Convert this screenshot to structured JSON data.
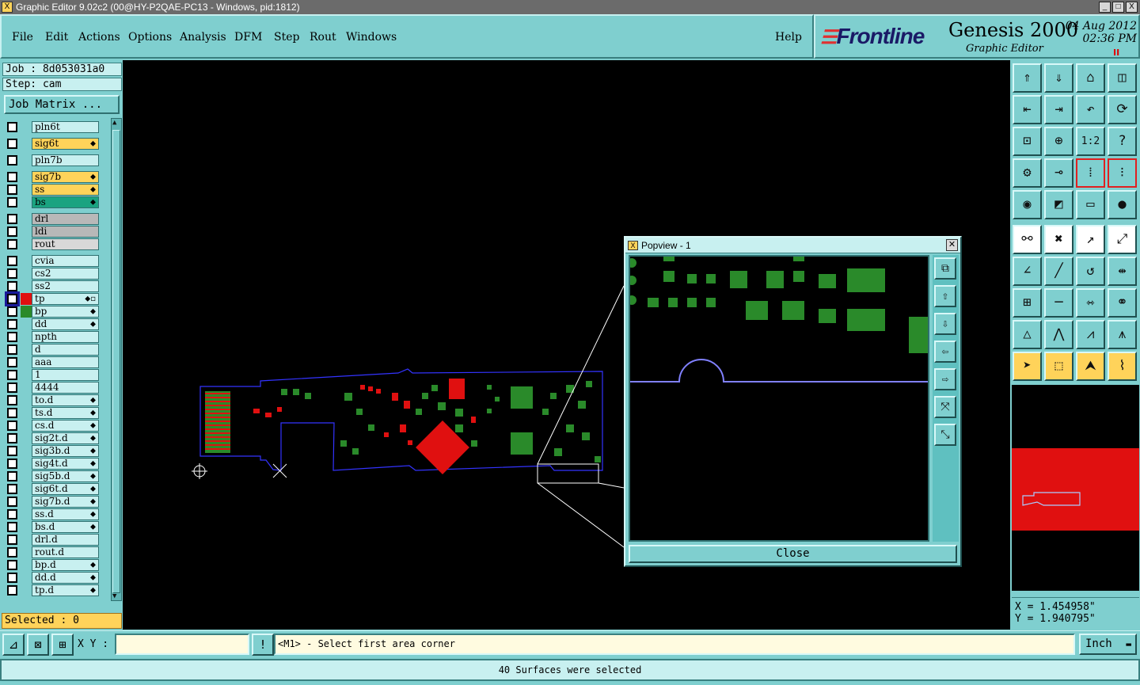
{
  "window": {
    "title": "Graphic Editor 9.02c2 (00@HY-P2QAE-PC13 - Windows, pid:1812)",
    "app_icon": "X",
    "minimize": "_",
    "maximize": "□",
    "close": "X"
  },
  "menu": [
    "File",
    "Edit",
    "Actions",
    "Options",
    "Analysis",
    "DFM",
    "Step",
    "Rout",
    "Windows",
    "Help"
  ],
  "brand": {
    "logo": "Frontline",
    "product": "Genesis 2000",
    "subtitle": "Graphic Editor",
    "date": "04 Aug 2012",
    "time": "02:36 PM",
    "pause": "II"
  },
  "job": {
    "label": "Job : 8d053031a0",
    "step": "Step: cam",
    "matrix_button": "Job Matrix ..."
  },
  "layers": [
    {
      "name": "pln6t",
      "color": "#c8f0f0",
      "swatch": "",
      "flag": ""
    },
    {
      "name": "sig6t",
      "color": "#ffd35a",
      "swatch": "",
      "flag": "⬥"
    },
    {
      "name": "pln7b",
      "color": "#c8f0f0",
      "swatch": "",
      "flag": ""
    },
    {
      "name": "sig7b",
      "color": "#ffd35a",
      "swatch": "",
      "flag": "⬥"
    },
    {
      "name": "ss",
      "color": "#ffd35a",
      "swatch": "",
      "flag": "⬥"
    },
    {
      "name": "bs",
      "color": "#1aa380",
      "swatch": "",
      "flag": "⬥"
    },
    {
      "name": "drl",
      "color": "#b8b8b8",
      "swatch": "",
      "flag": ""
    },
    {
      "name": "ldi",
      "color": "#b8b8b8",
      "swatch": "",
      "flag": ""
    },
    {
      "name": "rout",
      "color": "#d8d8d8",
      "swatch": "",
      "flag": ""
    },
    {
      "name": "cvia",
      "color": "#c8f0f0",
      "swatch": "",
      "flag": ""
    },
    {
      "name": "cs2",
      "color": "#c8f0f0",
      "swatch": "",
      "flag": ""
    },
    {
      "name": "ss2",
      "color": "#c8f0f0",
      "swatch": "",
      "flag": ""
    },
    {
      "name": "tp",
      "color": "#c8f0f0",
      "swatch": "#e01010",
      "flag": "⬥▫"
    },
    {
      "name": "bp",
      "color": "#c8f0f0",
      "swatch": "#2a8a2a",
      "flag": "⬥"
    },
    {
      "name": "dd",
      "color": "#c8f0f0",
      "swatch": "",
      "flag": "⬥"
    },
    {
      "name": "npth",
      "color": "#c8f0f0",
      "swatch": "",
      "flag": ""
    },
    {
      "name": "d",
      "color": "#c8f0f0",
      "swatch": "",
      "flag": ""
    },
    {
      "name": "aaa",
      "color": "#c8f0f0",
      "swatch": "",
      "flag": ""
    },
    {
      "name": "1",
      "color": "#c8f0f0",
      "swatch": "",
      "flag": ""
    },
    {
      "name": "4444",
      "color": "#c8f0f0",
      "swatch": "",
      "flag": ""
    },
    {
      "name": "to.d",
      "color": "#c8f0f0",
      "swatch": "",
      "flag": "⬥"
    },
    {
      "name": "ts.d",
      "color": "#c8f0f0",
      "swatch": "",
      "flag": "⬥"
    },
    {
      "name": "cs.d",
      "color": "#c8f0f0",
      "swatch": "",
      "flag": "⬥"
    },
    {
      "name": "sig2t.d",
      "color": "#c8f0f0",
      "swatch": "",
      "flag": "⬥"
    },
    {
      "name": "sig3b.d",
      "color": "#c8f0f0",
      "swatch": "",
      "flag": "⬥"
    },
    {
      "name": "sig4t.d",
      "color": "#c8f0f0",
      "swatch": "",
      "flag": "⬥"
    },
    {
      "name": "sig5b.d",
      "color": "#c8f0f0",
      "swatch": "",
      "flag": "⬥"
    },
    {
      "name": "sig6t.d",
      "color": "#c8f0f0",
      "swatch": "",
      "flag": "⬥"
    },
    {
      "name": "sig7b.d",
      "color": "#c8f0f0",
      "swatch": "",
      "flag": "⬥"
    },
    {
      "name": "ss.d",
      "color": "#c8f0f0",
      "swatch": "",
      "flag": "⬥"
    },
    {
      "name": "bs.d",
      "color": "#c8f0f0",
      "swatch": "",
      "flag": "⬥"
    },
    {
      "name": "drl.d",
      "color": "#c8f0f0",
      "swatch": "",
      "flag": ""
    },
    {
      "name": "rout.d",
      "color": "#c8f0f0",
      "swatch": "",
      "flag": ""
    },
    {
      "name": "bp.d",
      "color": "#c8f0f0",
      "swatch": "",
      "flag": "⬥"
    },
    {
      "name": "dd.d",
      "color": "#c8f0f0",
      "swatch": "",
      "flag": "⬥"
    },
    {
      "name": "tp.d",
      "color": "#c8f0f0",
      "swatch": "",
      "flag": "⬥"
    }
  ],
  "selected": "Selected : 0",
  "popview": {
    "title": "Popview - 1",
    "close_label": "Close",
    "tools": [
      "zoom-fit-icon",
      "pan-up-icon",
      "pan-down-icon",
      "pan-left-icon",
      "pan-right-icon",
      "zoom-in-icon",
      "zoom-out-icon"
    ]
  },
  "toolbox": [
    "zoom-up-icon",
    "zoom-down-icon",
    "home-icon",
    "split-view-icon",
    "pan-left-icon",
    "pan-right-icon",
    "undo-zoom-icon",
    "redraw-icon",
    "fit-icon",
    "center-icon",
    "ratio-icon",
    "help-icon",
    "measure-icon",
    "snap-icon",
    "layer-props-icon",
    "layer-select-icon",
    "add-pad-icon",
    "add-line-icon",
    "ruler-icon",
    "add-surface-icon",
    "connect-icon",
    "delete-icon",
    "move-icon",
    "copy-icon",
    "angle-icon",
    "line-tool-icon",
    "arc-icon",
    "split-icon",
    "resize-icon",
    "cut-icon",
    "stretch-icon",
    "transform-icon",
    "triangle-icon",
    "triangle-left-icon",
    "triangle-right-icon",
    "triangle-cross-icon",
    "select-arrow-icon",
    "select-box-icon",
    "select-touch-icon",
    "select-net-icon"
  ],
  "ratio_label": "1:2",
  "help_label": "?",
  "coords": {
    "x": "X = 1.454958\"",
    "y": "Y = 1.940795\""
  },
  "cmd": {
    "xy_label": "X Y :",
    "xy_value": "",
    "prompt": "<M1> - Select first area corner",
    "units": "Inch",
    "units_arrow": "▬"
  },
  "status": "40 Surfaces were selected",
  "colors": {
    "accent": "#7fcfcf",
    "top_layer": "#e01010",
    "bottom_layer": "#2a8a2a",
    "outline": "#2a2ae0",
    "highlight": "#ffd35a"
  }
}
